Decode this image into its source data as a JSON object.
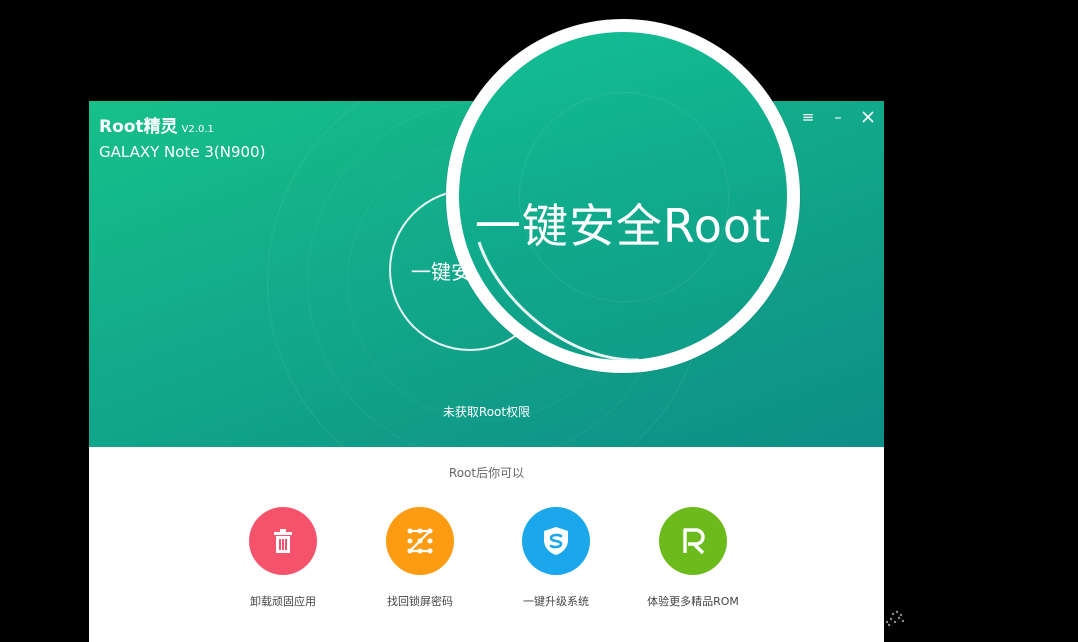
{
  "window": {
    "app_name": "Root精灵",
    "version": "V2.0.1",
    "device": "GALAXY Note 3(N900)",
    "controls": {
      "menu": "≡",
      "minimize": "–"
    }
  },
  "hero": {
    "root_button": "一键安",
    "status": "未获取Root权限"
  },
  "magnifier": {
    "text": "一键安全Root"
  },
  "lower": {
    "title": "Root后你可以",
    "features": [
      {
        "label": "卸载顽固应用",
        "icon": "trash-icon",
        "color": "#f5536b"
      },
      {
        "label": "找回锁屏密码",
        "icon": "pattern-lock-icon",
        "color": "#fd9b12"
      },
      {
        "label": "一键升级系统",
        "icon": "shield-icon",
        "color": "#1aa7ec"
      },
      {
        "label": "体验更多精品ROM",
        "icon": "rom-r-icon",
        "color": "#6cbb1d"
      }
    ]
  }
}
